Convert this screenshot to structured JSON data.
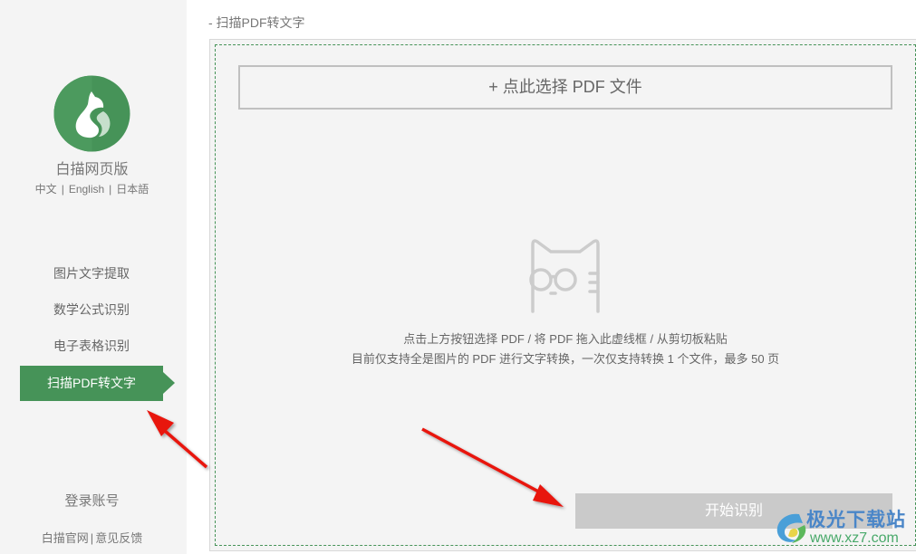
{
  "sidebar": {
    "app_name": "白描网页版",
    "languages": [
      "中文",
      "English",
      "日本語"
    ],
    "lang_separator": "|",
    "nav_items": [
      {
        "label": "图片文字提取",
        "active": false
      },
      {
        "label": "数学公式识别",
        "active": false
      },
      {
        "label": "电子表格识别",
        "active": false
      },
      {
        "label": "扫描PDF转文字",
        "active": true
      }
    ],
    "login_label": "登录账号",
    "footer_links": [
      "白描官网",
      "意见反馈"
    ],
    "footer_separator": "|"
  },
  "main": {
    "section_title": "- 扫描PDF转文字",
    "select_button_label": "+ 点此选择 PDF 文件",
    "hint_line_1": "点击上方按钮选择 PDF / 将 PDF 拖入此虚线框 / 从剪切板粘贴",
    "hint_line_2": "目前仅支持全是图片的 PDF 进行文字转换，一次仅支持转换 1 个文件，最多 50 页",
    "start_button_label": "开始识别",
    "empty_state_icon": "cat-with-glasses-icon"
  },
  "watermark": {
    "title": "极光下载站",
    "url": "www.xz7.com"
  },
  "colors": {
    "accent": "#469358",
    "sidebar_bg": "#f4f4f4",
    "disabled_button": "#cacaca",
    "annotation_arrow": "#e8120c"
  }
}
